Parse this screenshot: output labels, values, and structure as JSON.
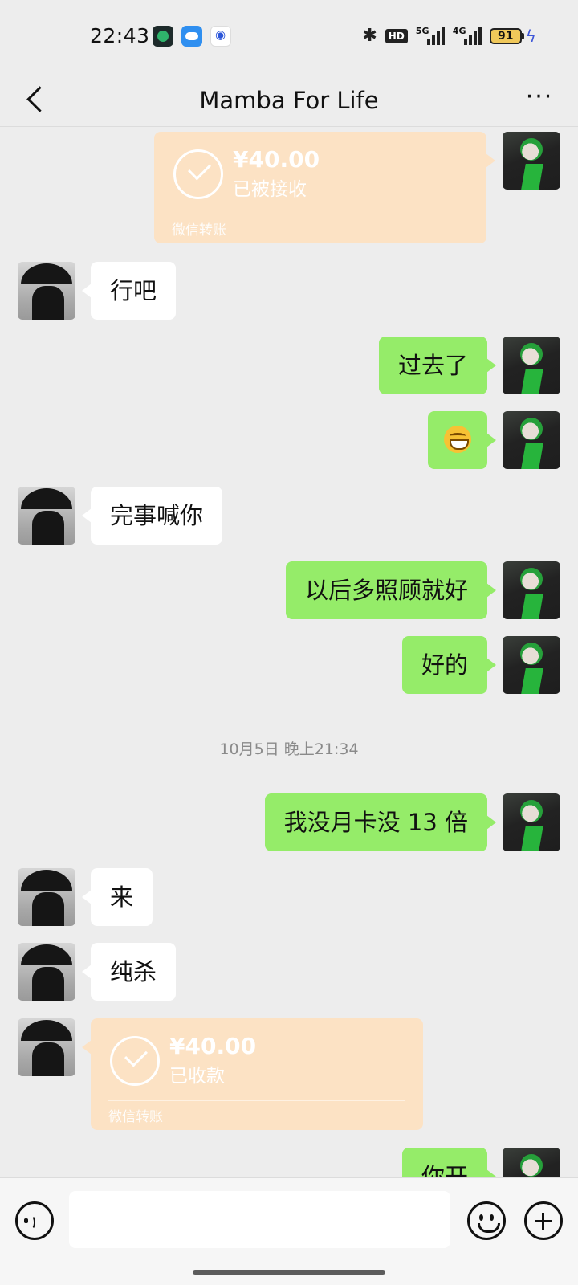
{
  "status_bar": {
    "time": "22:43",
    "network_labels": [
      "HD",
      "5G",
      "4G"
    ],
    "battery": "91"
  },
  "header": {
    "title": "Mamba For Life"
  },
  "transfers": [
    {
      "amount": "¥40.00",
      "status": "已被接收",
      "label": "微信转账"
    },
    {
      "amount": "¥40.00",
      "status": "已收款",
      "label": "微信转账"
    }
  ],
  "messages": [
    {
      "sender": "other",
      "text": "行吧"
    },
    {
      "sender": "me",
      "text": "过去了"
    },
    {
      "sender": "me",
      "emoji": "grinning-face"
    },
    {
      "sender": "other",
      "text": "完事喊你"
    },
    {
      "sender": "me",
      "text": "以后多照顾就好"
    },
    {
      "sender": "me",
      "text": "好的"
    },
    {
      "sender": "me",
      "text": "我没月卡没 13 倍"
    },
    {
      "sender": "other",
      "text": "来"
    },
    {
      "sender": "other",
      "text": "纯杀"
    },
    {
      "sender": "me",
      "text": "你开"
    }
  ],
  "timestamp": "10月5日 晚上21:34"
}
